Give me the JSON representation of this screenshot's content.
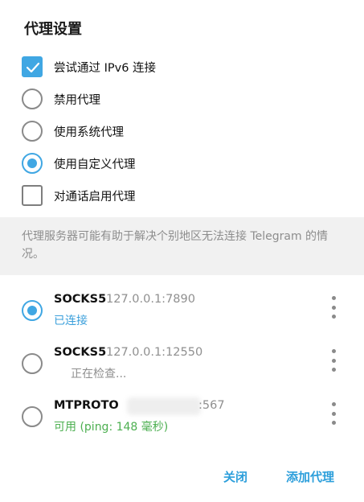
{
  "dialog": {
    "title": "代理设置"
  },
  "options": {
    "ipv6": {
      "label": "尝试通过 IPv6 连接",
      "checked": true
    },
    "disable_proxy": {
      "label": "禁用代理",
      "selected": false
    },
    "system_proxy": {
      "label": "使用系统代理",
      "selected": false
    },
    "custom_proxy": {
      "label": "使用自定义代理",
      "selected": true
    },
    "calls_proxy": {
      "label": "对通话启用代理",
      "checked": false
    }
  },
  "note": "代理服务器可能有助于解决个别地区无法连接 Telegram 的情况。",
  "proxies": [
    {
      "type": "SOCKS5",
      "address": "127.0.0.1:7890",
      "status": "已连接",
      "selected": true
    },
    {
      "type": "SOCKS5",
      "address": "127.0.0.1:12550",
      "status": "正在检查...",
      "selected": false
    },
    {
      "type": "MTPROTO",
      "address": ":567",
      "status": "可用 (ping: 148 毫秒)",
      "selected": false
    }
  ],
  "buttons": {
    "close": "关闭",
    "add_proxy": "添加代理"
  },
  "colors": {
    "accent": "#40a7e3",
    "link": "#2d9fdb",
    "status_ok": "#4caf50"
  }
}
